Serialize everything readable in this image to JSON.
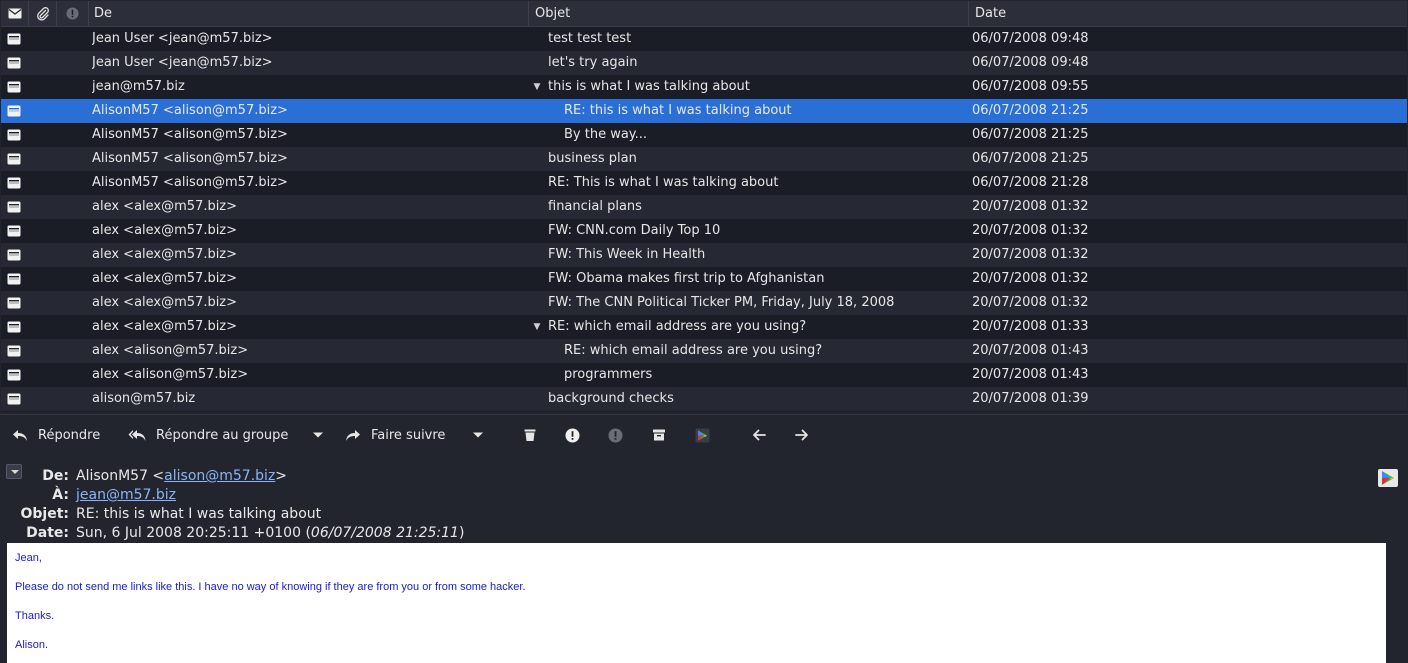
{
  "list": {
    "columns": {
      "from": "De",
      "subject": "Objet",
      "date": "Date"
    },
    "rows": [
      {
        "from": "Jean User <jean@m57.biz>",
        "subject": "test test test",
        "date": "06/07/2008 09:48"
      },
      {
        "from": "Jean User <jean@m57.biz>",
        "subject": "let's try again",
        "date": "06/07/2008 09:48"
      },
      {
        "from": "jean@m57.biz",
        "subject": "this is what I was talking about",
        "date": "06/07/2008 09:55"
      },
      {
        "from": "AlisonM57 <alison@m57.biz>",
        "subject": "RE: this is what I was talking about",
        "date": "06/07/2008 21:25"
      },
      {
        "from": "AlisonM57 <alison@m57.biz>",
        "subject": "By the way...",
        "date": "06/07/2008 21:25"
      },
      {
        "from": "AlisonM57 <alison@m57.biz>",
        "subject": "business plan",
        "date": "06/07/2008 21:25"
      },
      {
        "from": "AlisonM57 <alison@m57.biz>",
        "subject": "RE: This is what I was talking about",
        "date": "06/07/2008 21:28"
      },
      {
        "from": "alex <alex@m57.biz>",
        "subject": "financial plans",
        "date": "20/07/2008 01:32"
      },
      {
        "from": "alex <alex@m57.biz>",
        "subject": "FW: CNN.com Daily Top 10",
        "date": "20/07/2008 01:32"
      },
      {
        "from": "alex <alex@m57.biz>",
        "subject": "FW: This Week in Health",
        "date": "20/07/2008 01:32"
      },
      {
        "from": "alex <alex@m57.biz>",
        "subject": "FW: Obama makes first trip to Afghanistan",
        "date": "20/07/2008 01:32"
      },
      {
        "from": "alex <alex@m57.biz>",
        "subject": "FW: The CNN Political Ticker PM, Friday, July 18, 2008",
        "date": "20/07/2008 01:32"
      },
      {
        "from": "alex <alex@m57.biz>",
        "subject": "RE: which email address are you using?",
        "date": "20/07/2008 01:33"
      },
      {
        "from": "alex <alison@m57.biz>",
        "subject": "RE: which email address are you using?",
        "date": "20/07/2008 01:43"
      },
      {
        "from": "alex <alison@m57.biz>",
        "subject": "programmers",
        "date": "20/07/2008 01:43"
      },
      {
        "from": "alison@m57.biz",
        "subject": "background checks",
        "date": "20/07/2008 01:39"
      }
    ]
  },
  "toolbar": {
    "reply": "Répondre",
    "reply_all": "Répondre au groupe",
    "forward": "Faire suivre"
  },
  "header": {
    "from_label": "De:",
    "from_name": "AlisonM57 <",
    "from_email": "alison@m57.biz",
    "from_close": ">",
    "to_label": "À:",
    "to_email": "jean@m57.biz",
    "subject_label": "Objet:",
    "subject": "RE: this is what I was talking about",
    "date_label": "Date:",
    "date_raw": "Sun, 6 Jul 2008 20:25:11 +0100 (",
    "date_local": "06/07/2008 21:25:11",
    "date_close": ")"
  },
  "body": {
    "line1": "Jean,",
    "line2": "Please do not send me links like this. I have no way of knowing if they are from you or from some hacker.",
    "line3": "Thanks.",
    "line4": "Alison."
  },
  "colors": {
    "selected_row": "#2a6fd6",
    "link": "#8ab4f8",
    "body_text": "#1a1acc"
  }
}
